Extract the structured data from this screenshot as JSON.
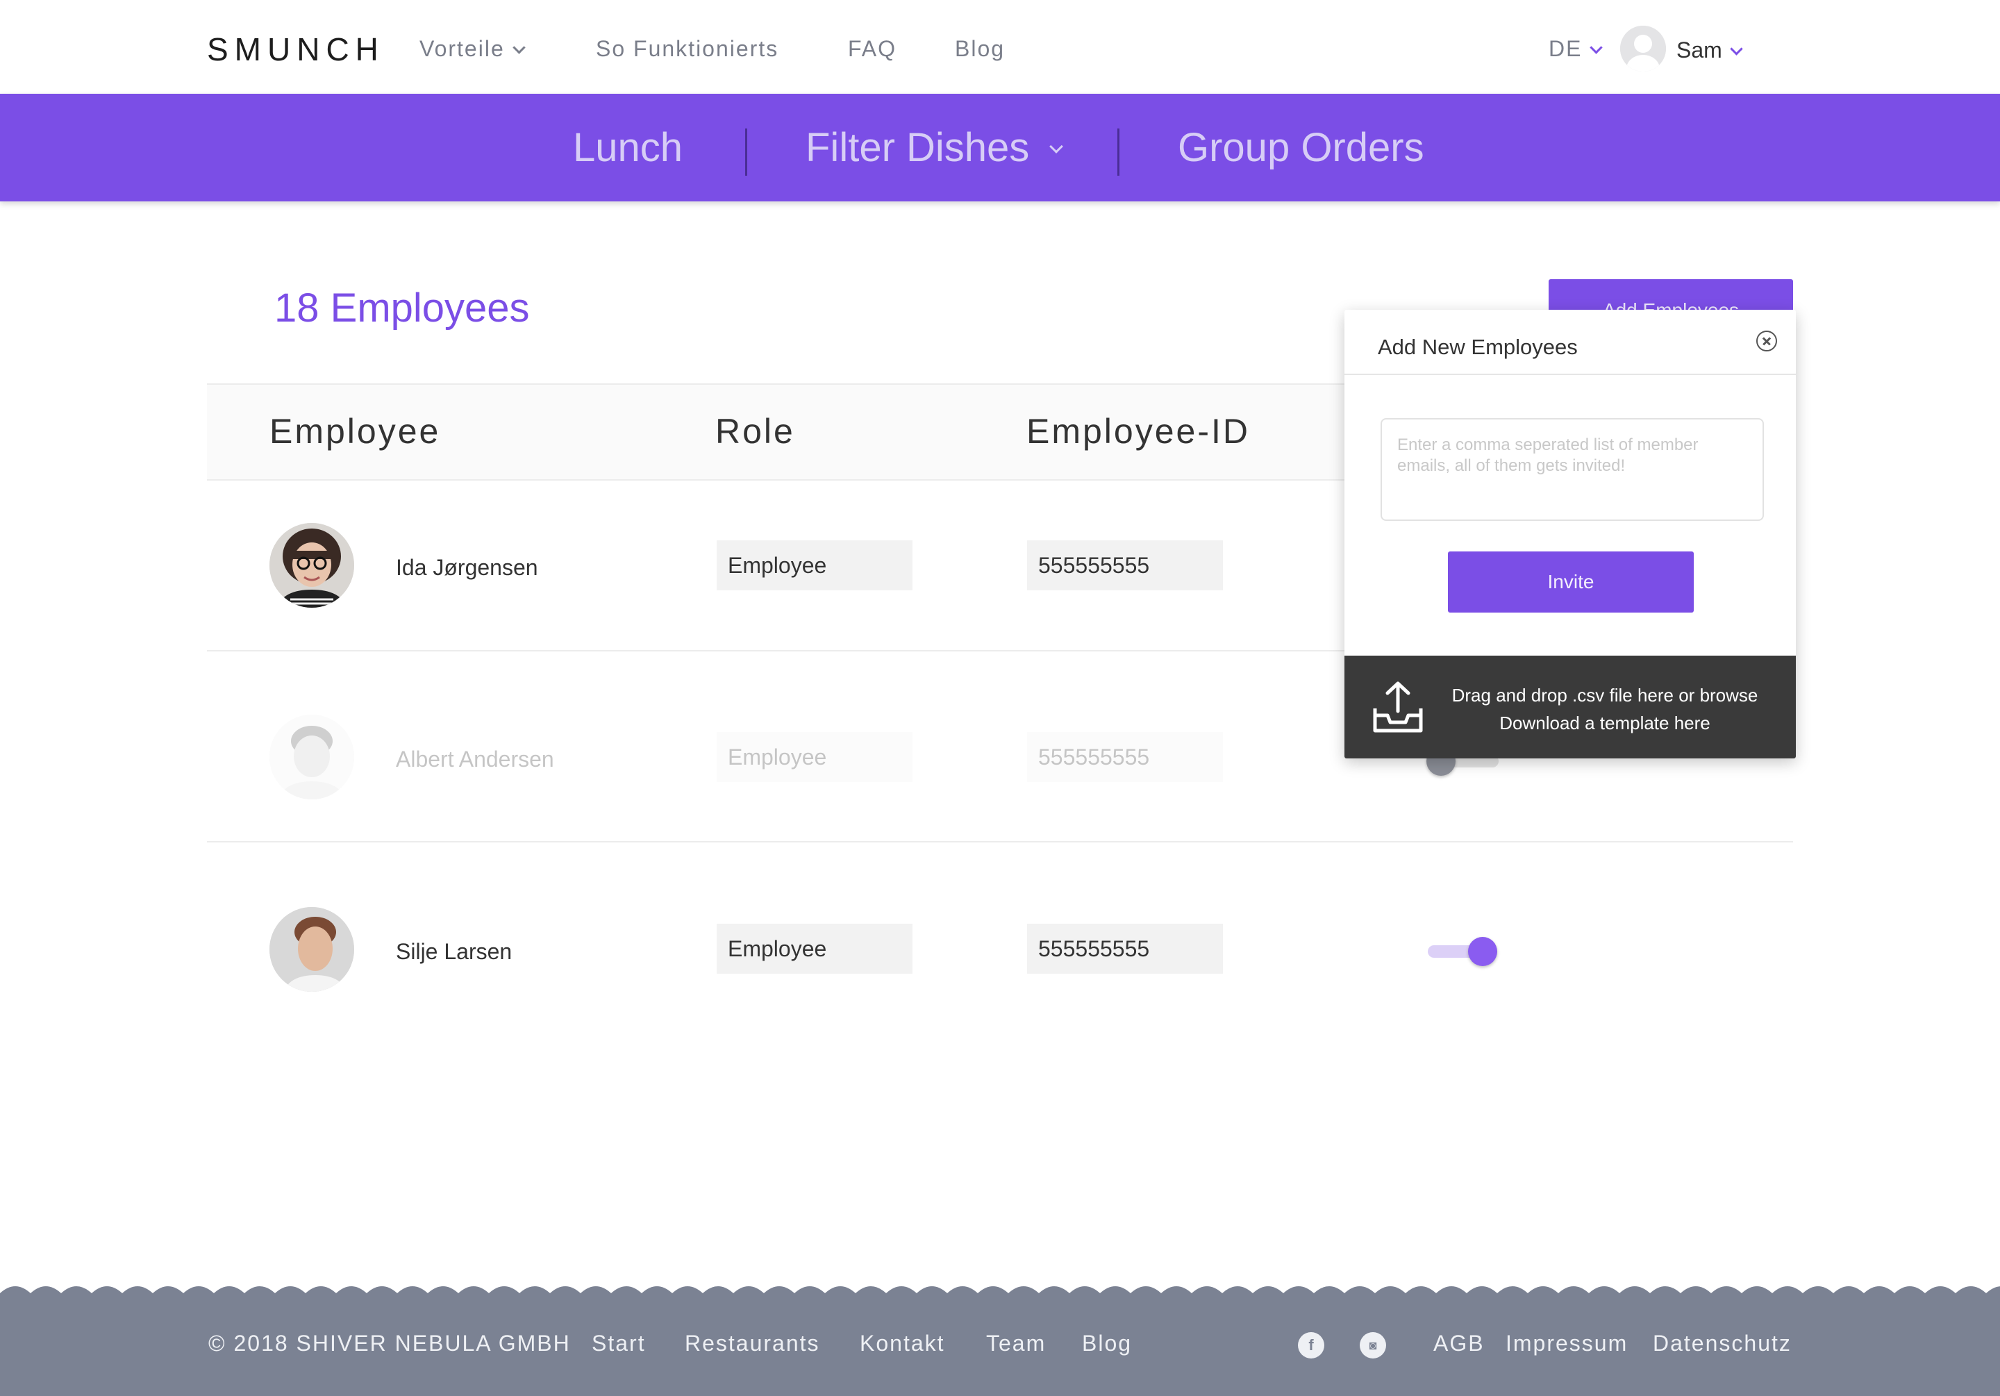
{
  "nav": {
    "logo": "SMUNCH",
    "links": [
      "Vorteile",
      "So Funktionierts",
      "FAQ",
      "Blog"
    ],
    "lang": "DE",
    "user": "Sam"
  },
  "band": {
    "items": [
      "Lunch",
      "Filter Dishes",
      "Group Orders"
    ]
  },
  "main": {
    "count_title": "18 Employees",
    "add_button": "Add Employees"
  },
  "table": {
    "headers": [
      "Employee",
      "Role",
      "Employee-ID"
    ],
    "rows": [
      {
        "name": "Ida Jørgensen",
        "role": "Employee",
        "id": "555555555",
        "active": true
      },
      {
        "name": "Albert Andersen",
        "role": "Employee",
        "id": "555555555",
        "active": false
      },
      {
        "name": "Silje Larsen",
        "role": "Employee",
        "id": "555555555",
        "active": true
      }
    ]
  },
  "popover": {
    "title": "Add New Employees",
    "placeholder": "Enter a comma seperated list of member emails, all of them gets invited!",
    "invite": "Invite",
    "drop_line1": "Drag and drop .csv file here or browse",
    "drop_line2": "Download a template here"
  },
  "footer": {
    "copyright": "© 2018 SHIVER NEBULA GMBH",
    "links": [
      "Start",
      "Restaurants",
      "Kontakt",
      "Team",
      "Blog"
    ],
    "social": [
      "f",
      "◙"
    ],
    "legal": [
      "AGB",
      "Impressum",
      "Datenschutz"
    ]
  },
  "colors": {
    "accent": "#7b4ee6",
    "footer": "#7b8293",
    "drop_zone": "#3a3a3a"
  }
}
